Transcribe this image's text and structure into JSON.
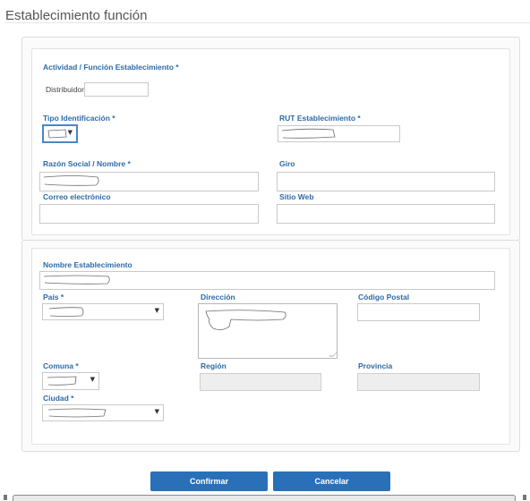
{
  "page": {
    "title": "Establecimiento función"
  },
  "section1": {
    "heading": "Actividad / Función Establecimiento *",
    "distribuidor_label": "Distribuidor",
    "distribuidor_value": "",
    "tipo_identificacion_label": "Tipo Identificación *",
    "tipo_identificacion_value": "",
    "rut_label": "RUT Establecimiento *",
    "razon_social_label": "Razón Social / Nombre *",
    "giro_label": "Giro",
    "giro_value": "",
    "correo_label": "Correo electrónico",
    "correo_value": "",
    "sitio_web_label": "Sitio Web",
    "sitio_web_value": ""
  },
  "section2": {
    "nombre_label": "Nombre Establecimiento",
    "pais_label": "País *",
    "direccion_label": "Dirección",
    "codigo_postal_label": "Código Postal",
    "codigo_postal_value": "",
    "comuna_label": "Comuna *",
    "region_label": "Región",
    "provincia_label": "Provincia",
    "ciudad_label": "Ciudad *"
  },
  "actions": {
    "confirm_label": "Confirmar",
    "cancel_label": "Cancelar"
  },
  "colors": {
    "label_blue": "#2c6aa8",
    "button_blue": "#2a70b8",
    "focus_blue": "#4a86c8",
    "disabled_gray": "#eeeeee"
  },
  "icons": {
    "select_caret": "caret-down-icon"
  }
}
